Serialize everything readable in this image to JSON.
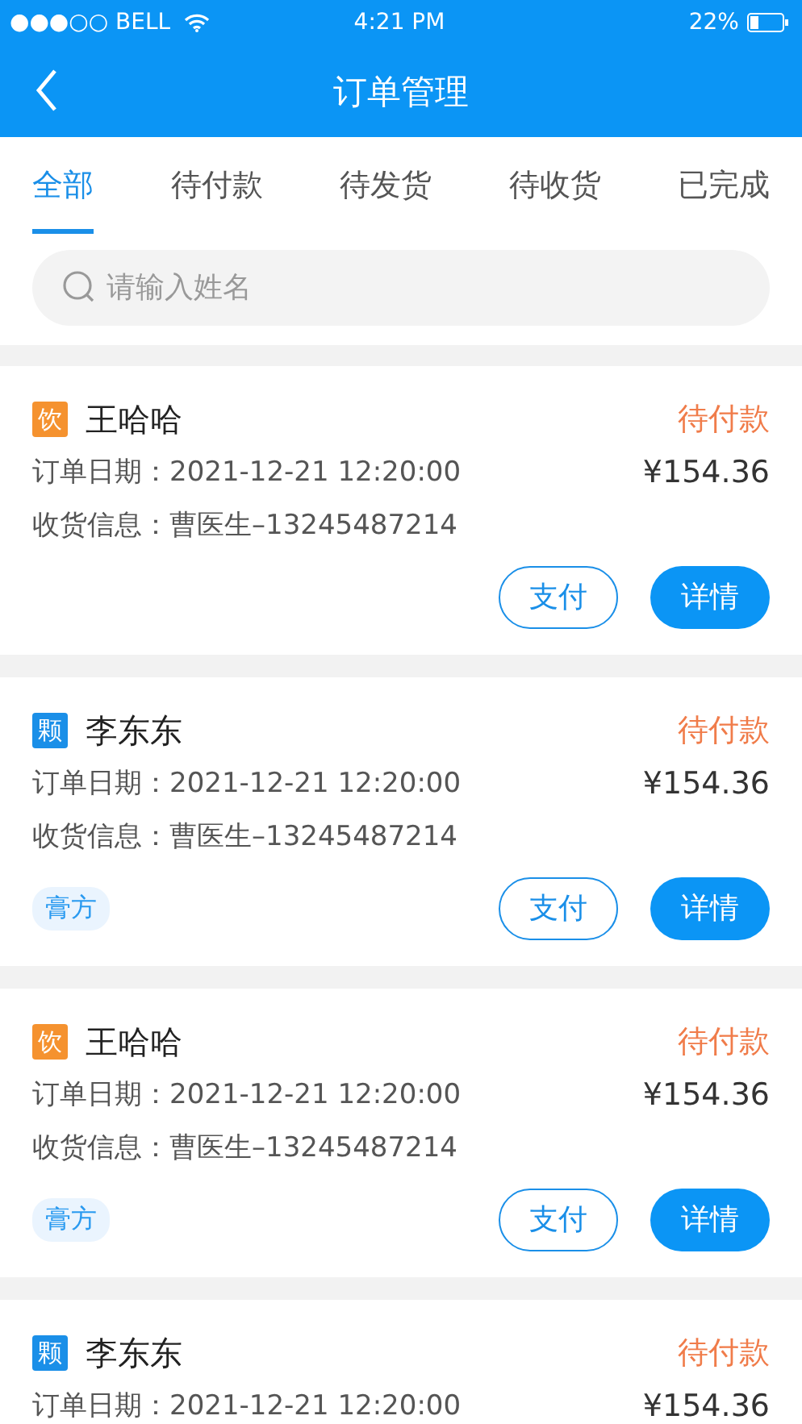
{
  "status_bar": {
    "signal": "●●●○○ BELL",
    "time": "4:21 PM",
    "battery": "22%"
  },
  "nav": {
    "title": "订单管理"
  },
  "tabs": [
    {
      "label": "全部",
      "selected": true
    },
    {
      "label": "待付款",
      "selected": false
    },
    {
      "label": "待发货",
      "selected": false
    },
    {
      "label": "待收货",
      "selected": false
    },
    {
      "label": "已完成",
      "selected": false
    }
  ],
  "search": {
    "placeholder": "请输入姓名"
  },
  "orders": [
    {
      "badge": "饮",
      "color": "#f5922f",
      "name": "王哈哈",
      "status": "待付款",
      "date_label": "订单日期：",
      "date": "2021-12-21 12:20:00",
      "price": "¥154.36",
      "address_label": "收货信息：",
      "address": "曹医生–13245487214",
      "buttons": [
        "支付",
        "详情"
      ]
    },
    {
      "badge": "颗",
      "color": "#1a8fe8",
      "name": "李东东",
      "status": "待付款",
      "date_label": "订单日期：",
      "date": "2021-12-21 12:20:00",
      "price": "¥154.36",
      "address_label": "收货信息：",
      "address": "曹医生–13245487214",
      "tag": "膏方",
      "buttons": [
        "支付",
        "详情"
      ]
    },
    {
      "badge": "饮",
      "color": "#f5922f",
      "name": "王哈哈",
      "status": "待付款",
      "date_label": "订单日期：",
      "date": "2021-12-21 12:20:00",
      "price": "¥154.36",
      "address_label": "收货信息：",
      "address": "曹医生–13245487214",
      "tag": "膏方",
      "buttons": [
        "支付",
        "详情"
      ]
    },
    {
      "badge": "颗",
      "color": "#1a8fe8",
      "name": "李东东",
      "status": "待付款",
      "date_label": "订单日期：",
      "date": "2021-12-21 12:20:00",
      "price": "¥154.36"
    }
  ]
}
